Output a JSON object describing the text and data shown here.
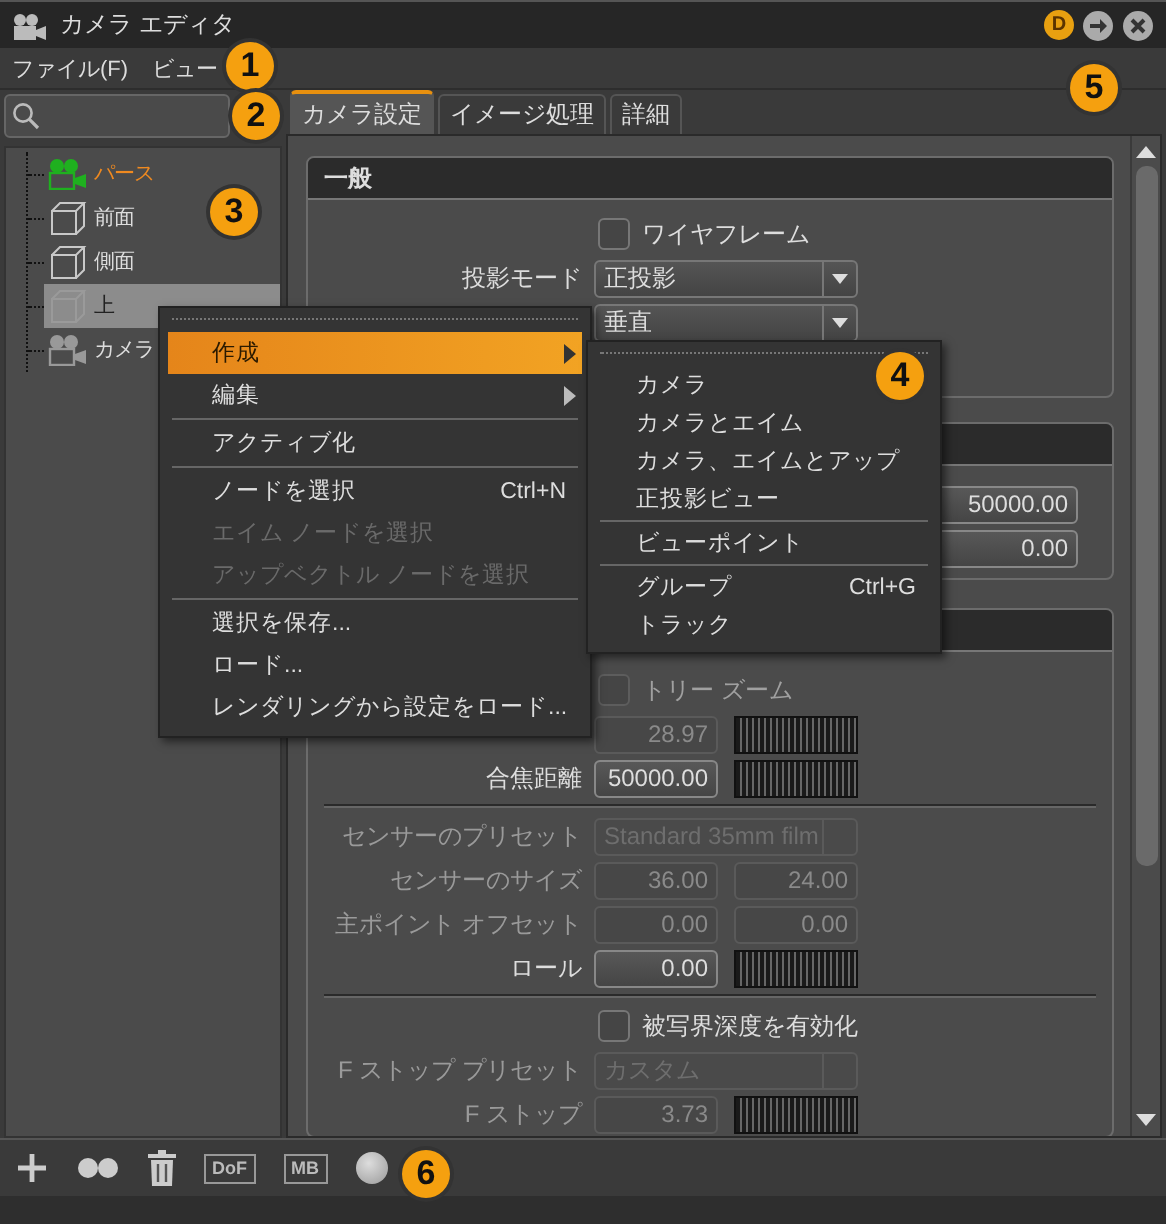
{
  "window": {
    "title": "カメラ エディタ",
    "badge": "D"
  },
  "menu_bar": [
    {
      "label": "ファイル(F)"
    },
    {
      "label": "ビュー"
    }
  ],
  "tree": [
    {
      "label": "パース",
      "kind": "camera",
      "active": true,
      "selected": false
    },
    {
      "label": "前面",
      "kind": "cube",
      "active": false,
      "selected": false
    },
    {
      "label": "側面",
      "kind": "cube",
      "active": false,
      "selected": false
    },
    {
      "label": "上",
      "kind": "cube",
      "active": false,
      "selected": true
    },
    {
      "label": "カメラ",
      "kind": "camera",
      "active": false,
      "selected": false
    }
  ],
  "tabs": [
    {
      "label": "カメラ設定",
      "selected": true
    },
    {
      "label": "イメージ処理",
      "selected": false
    },
    {
      "label": "詳細",
      "selected": false
    }
  ],
  "sections": [
    {
      "title": "一般",
      "rows": [
        {
          "kind": "checkbox",
          "label": "ワイヤフレーム",
          "checked": false,
          "disabled": false
        },
        {
          "kind": "dropdown",
          "label": "投影モード",
          "value": "正投影",
          "disabled": false
        },
        {
          "kind": "dropdown",
          "value": "垂直",
          "disabled": false
        }
      ]
    },
    {
      "rows": [
        {
          "kind": "wide",
          "value": "50000.00",
          "disabled": false
        },
        {
          "kind": "wide",
          "value": "0.00",
          "disabled": false
        }
      ]
    },
    {
      "rows": [
        {
          "kind": "checkbox",
          "label": "トリー ズーム",
          "checked": false,
          "disabled": true
        },
        {
          "kind": "number",
          "value": "28.97",
          "disabled": true
        },
        {
          "kind": "number",
          "label": "合焦距離",
          "value": "50000.00",
          "disabled": false
        },
        {
          "kind": "divider"
        },
        {
          "kind": "dropdown",
          "label": "センサーのプリセット",
          "value": "Standard 35mm film",
          "disabled": true
        },
        {
          "kind": "pair",
          "label": "センサーのサイズ",
          "values": [
            "36.00",
            "24.00"
          ],
          "disabled": true
        },
        {
          "kind": "pair",
          "label": "主ポイント オフセット",
          "values": [
            "0.00",
            "0.00"
          ],
          "disabled": true
        },
        {
          "kind": "number",
          "label": "ロール",
          "value": "0.00",
          "disabled": false
        },
        {
          "kind": "divider"
        },
        {
          "kind": "checkbox",
          "label": "被写界深度を有効化",
          "checked": false,
          "disabled": false
        },
        {
          "kind": "dropdown",
          "label": "F ストップ プリセット",
          "value": "カスタム",
          "disabled": true
        },
        {
          "kind": "number",
          "label": "F ストップ",
          "value": "3.73",
          "disabled": true
        }
      ]
    }
  ],
  "context_menu": [
    {
      "kind": "item",
      "label": "作成",
      "submenu": true,
      "selected": true,
      "disabled": false
    },
    {
      "kind": "item",
      "label": "編集",
      "submenu": true,
      "selected": false,
      "disabled": false
    },
    {
      "kind": "separator"
    },
    {
      "kind": "item",
      "label": "アクティブ化",
      "submenu": false,
      "selected": false,
      "disabled": false
    },
    {
      "kind": "separator"
    },
    {
      "kind": "item",
      "label": "ノードを選択",
      "shortcut": "Ctrl+N",
      "submenu": false,
      "selected": false,
      "disabled": false
    },
    {
      "kind": "item",
      "label": "エイム ノードを選択",
      "submenu": false,
      "selected": false,
      "disabled": true
    },
    {
      "kind": "item",
      "label": "アップベクトル ノードを選択",
      "submenu": false,
      "selected": false,
      "disabled": true
    },
    {
      "kind": "separator"
    },
    {
      "kind": "item",
      "label": "選択を保存...",
      "submenu": false,
      "selected": false,
      "disabled": false
    },
    {
      "kind": "item",
      "label": "ロード...",
      "submenu": false,
      "selected": false,
      "disabled": false
    },
    {
      "kind": "item",
      "label": "レンダリングから設定をロード...",
      "submenu": false,
      "selected": false,
      "disabled": false
    }
  ],
  "submenu": [
    {
      "kind": "item",
      "label": "カメラ"
    },
    {
      "kind": "item",
      "label": "カメラとエイム"
    },
    {
      "kind": "item",
      "label": "カメラ、エイムとアップ"
    },
    {
      "kind": "item",
      "label": "正投影ビュー"
    },
    {
      "kind": "separator"
    },
    {
      "kind": "item",
      "label": "ビューポイント"
    },
    {
      "kind": "separator"
    },
    {
      "kind": "item",
      "label": "グループ",
      "shortcut": "Ctrl+G"
    },
    {
      "kind": "item",
      "label": "トラック"
    }
  ],
  "toolbar": [
    {
      "kind": "add"
    },
    {
      "kind": "dots"
    },
    {
      "kind": "trash"
    },
    {
      "kind": "text",
      "label": "DoF"
    },
    {
      "kind": "text",
      "label": "MB"
    },
    {
      "kind": "circle"
    }
  ],
  "callouts": [
    {
      "label": "1"
    },
    {
      "label": "2"
    },
    {
      "label": "3"
    },
    {
      "label": "4"
    },
    {
      "label": "5"
    },
    {
      "label": "6"
    }
  ]
}
